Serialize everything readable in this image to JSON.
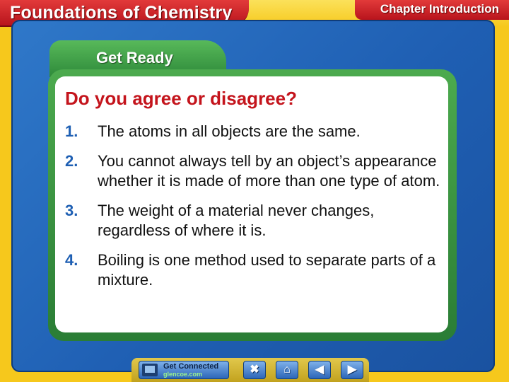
{
  "header": {
    "title": "Foundations of Chemistry",
    "chapter_label": "Chapter Introduction"
  },
  "tab": {
    "label": "Get Ready"
  },
  "content": {
    "question": "Do you agree or disagree?",
    "items": [
      {
        "num": "1.",
        "text": "The atoms in all objects are the same."
      },
      {
        "num": "2.",
        "text": "You cannot always tell by an object’s appearance whether it is made  of more than one type of atom."
      },
      {
        "num": "3.",
        "text": "The weight of a material never changes, regardless of where it is."
      },
      {
        "num": "4.",
        "text": "Boiling is one method used to separate parts of a mixture."
      }
    ]
  },
  "nav": {
    "get_connected": {
      "line1": "Get Connected",
      "line2": "glencoe.com",
      "icon": "monitor-icon"
    },
    "buttons": [
      {
        "icon": "close-icon",
        "glyph": "✖"
      },
      {
        "icon": "home-icon",
        "glyph": "⌂"
      },
      {
        "icon": "previous-icon",
        "glyph": "◀"
      },
      {
        "icon": "next-icon",
        "glyph": "▶"
      }
    ]
  },
  "colors": {
    "background": "#f6c81c",
    "header_red": "#c41c22",
    "panel_blue": "#2266b8",
    "tab_green": "#3a9a44",
    "question_red": "#c4141c",
    "number_blue": "#1e5fb3"
  }
}
